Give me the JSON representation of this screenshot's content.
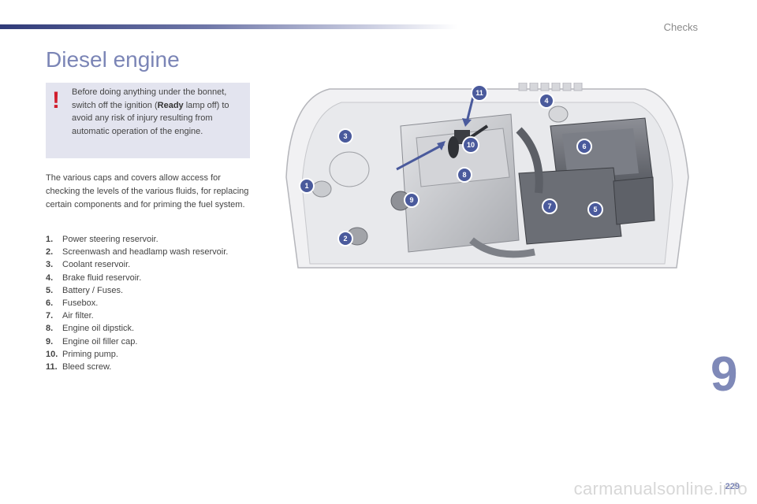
{
  "header": {
    "section": "Checks"
  },
  "title": "Diesel engine",
  "warning": {
    "text_before": "Before doing anything under the bonnet, switch off the ignition (",
    "bold": "Ready",
    "text_after": " lamp off) to avoid any risk of injury resulting from automatic operation of the engine."
  },
  "intro": "The various caps and covers allow access for checking the levels of the various fluids, for replacing certain components and for priming the fuel system.",
  "legend": [
    {
      "num": "1.",
      "label": "Power steering reservoir."
    },
    {
      "num": "2.",
      "label": "Screenwash and headlamp wash reservoir."
    },
    {
      "num": "3.",
      "label": "Coolant reservoir."
    },
    {
      "num": "4.",
      "label": "Brake fluid reservoir."
    },
    {
      "num": "5.",
      "label": "Battery / Fuses."
    },
    {
      "num": "6.",
      "label": "Fusebox."
    },
    {
      "num": "7.",
      "label": "Air filter."
    },
    {
      "num": "8.",
      "label": "Engine oil dipstick."
    },
    {
      "num": "9.",
      "label": "Engine oil filler cap."
    },
    {
      "num": "10.",
      "label": "Priming pump."
    },
    {
      "num": "11.",
      "label": "Bleed screw."
    }
  ],
  "diagram_callouts": [
    "1",
    "2",
    "3",
    "4",
    "5",
    "6",
    "7",
    "8",
    "9",
    "10",
    "11"
  ],
  "chapter": "9",
  "page_number": "229",
  "watermark": "carmanualsonline.info",
  "colors": {
    "accent": "#7b85b6",
    "warning_red": "#d11e2d",
    "callout": "#4a5a9c",
    "box_bg": "#e3e4ef"
  }
}
